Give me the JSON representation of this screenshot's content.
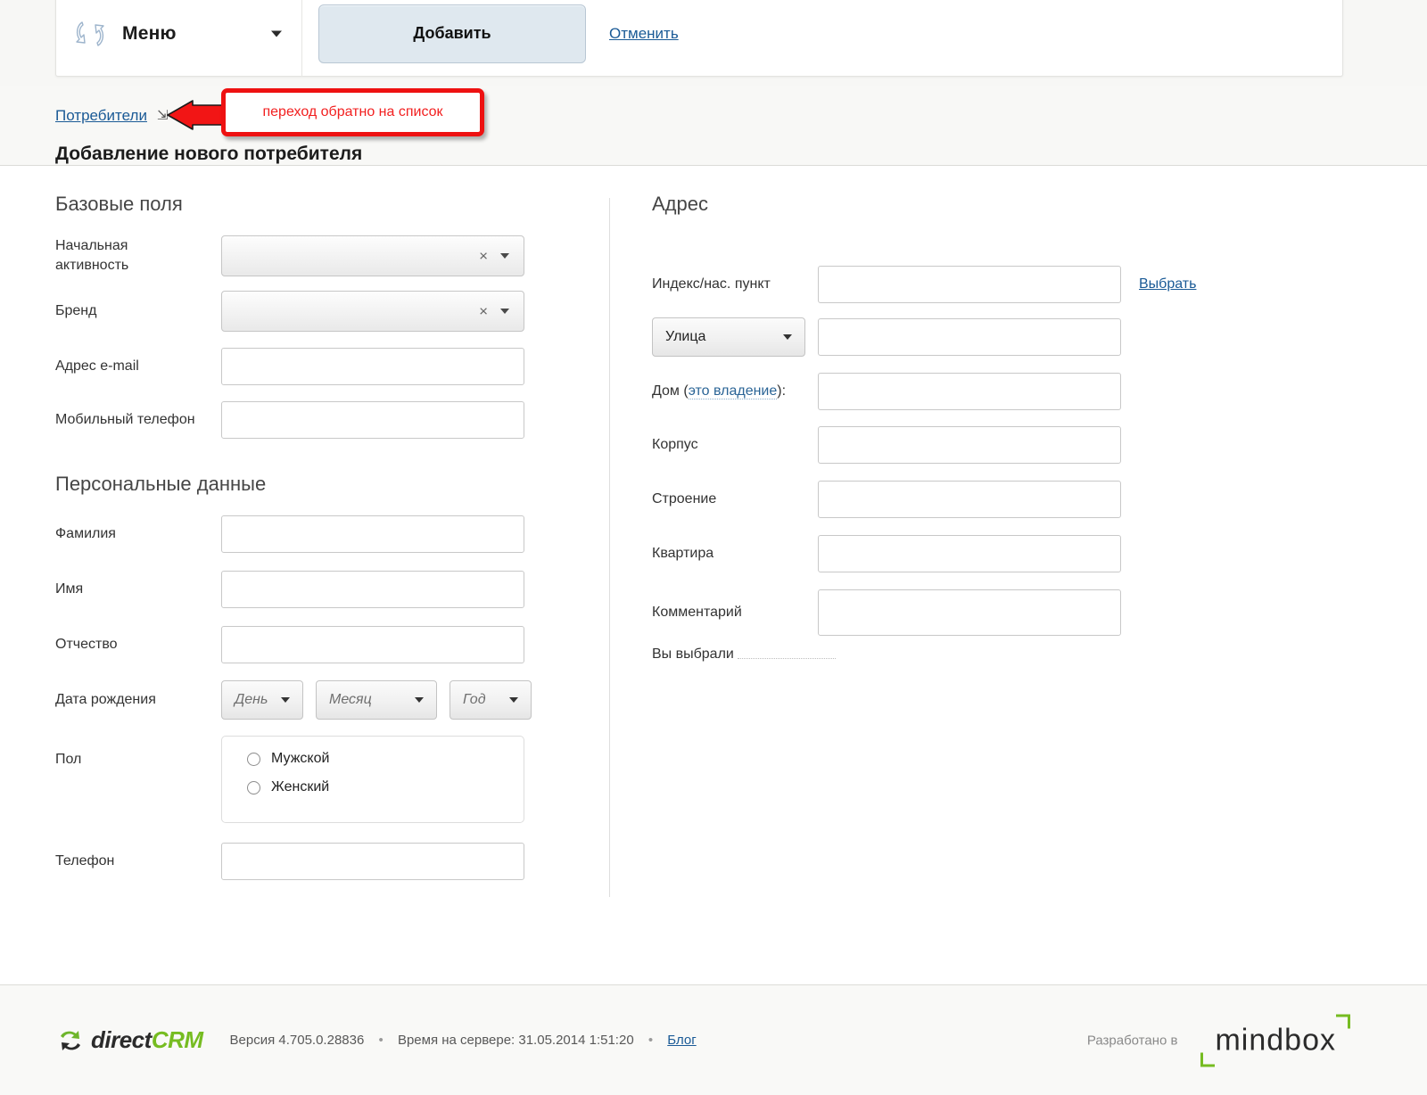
{
  "toolbar": {
    "menu_label": "Меню",
    "menu_icon": "circular-arrows-icon",
    "add_button": "Добавить",
    "cancel_link": "Отменить"
  },
  "breadcrumb": {
    "link": "Потребители",
    "arrow_glyph": "⇲"
  },
  "page_title": "Добавление нового потребителя",
  "annotation": {
    "text": "переход обратно на список",
    "border_color": "#ee1111",
    "text_color": "#f22020"
  },
  "left_column": {
    "basic_section": {
      "title": "Базовые поля",
      "fields": [
        {
          "label": "Начальная\nактивность",
          "type": "combo",
          "value": "",
          "clear_glyph": "×"
        },
        {
          "label": "Бренд",
          "type": "combo",
          "value": "",
          "clear_glyph": "×"
        },
        {
          "label": "Адрес e-mail",
          "type": "text",
          "value": ""
        },
        {
          "label": "Мобильный телефон",
          "type": "text",
          "value": ""
        }
      ]
    },
    "personal_section": {
      "title": "Персональные данные",
      "fields": [
        {
          "label": "Фамилия",
          "type": "text",
          "value": ""
        },
        {
          "label": "Имя",
          "type": "text",
          "value": ""
        },
        {
          "label": "Отчество",
          "type": "text",
          "value": ""
        }
      ],
      "birthdate": {
        "label": "Дата рождения",
        "day_placeholder": "День",
        "month_placeholder": "Месяц",
        "year_placeholder": "Год"
      },
      "gender": {
        "label": "Пол",
        "options": [
          {
            "label": "Мужской",
            "selected": false
          },
          {
            "label": "Женский",
            "selected": false
          }
        ]
      },
      "phone": {
        "label": "Телефон",
        "value": ""
      }
    }
  },
  "right_column": {
    "title": "Адрес",
    "index_field": {
      "label": "Индекс/нас. пункт",
      "value": "",
      "pick_link": "Выбрать"
    },
    "street_row": {
      "type_value": "Улица",
      "value": ""
    },
    "house_field": {
      "label_prefix": "Дом (",
      "label_link": "это владение",
      "label_suffix": "):",
      "value": ""
    },
    "fields": [
      {
        "label": "Корпус",
        "value": ""
      },
      {
        "label": "Строение",
        "value": ""
      },
      {
        "label": "Квартира",
        "value": ""
      },
      {
        "label": "Комментарий",
        "value": ""
      }
    ],
    "chosen": {
      "label": "Вы выбрали",
      "value": ""
    }
  },
  "footer": {
    "logo_dark": "direct",
    "logo_green": "CRM",
    "version": "Версия 4.705.0.28836",
    "server_time": "Время на сервере: 31.05.2014 1:51:20",
    "blog_link": "Блог",
    "separator": "•",
    "developed_by": "Разработано в",
    "mindbox": "mindbox"
  }
}
